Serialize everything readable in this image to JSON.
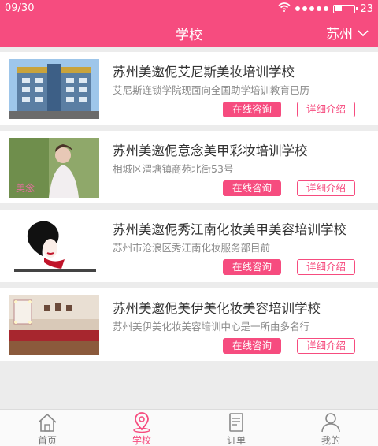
{
  "status": {
    "time": "09/30",
    "battery": "23"
  },
  "nav": {
    "title": "学校",
    "city": "苏州"
  },
  "schools": [
    {
      "name": "苏州美邀伲艾尼斯美妆培训学校",
      "desc": "艾尼斯连锁学院现面向全国助学培训教育已历",
      "consult": "在线咨询",
      "detail": "详细介绍"
    },
    {
      "name": "苏州美邀伲意念美甲彩妆培训学校",
      "desc": "相城区渭塘镇商苑北街53号",
      "consult": "在线咨询",
      "detail": "详细介绍"
    },
    {
      "name": "苏州美邀伲秀江南化妆美甲美容培训学校",
      "desc": "苏州市沧浪区秀江南化妆服务部目前",
      "consult": "在线咨询",
      "detail": "详细介绍"
    },
    {
      "name": "苏州美邀伲美伊美化妆美容培训学校",
      "desc": "苏州美伊美化妆美容培训中心是一所由多名行",
      "consult": "在线咨询",
      "detail": "详细介绍"
    }
  ],
  "tabs": [
    {
      "label": "首页",
      "icon": "home-icon"
    },
    {
      "label": "学校",
      "icon": "location-icon"
    },
    {
      "label": "订单",
      "icon": "order-icon"
    },
    {
      "label": "我的",
      "icon": "user-icon"
    }
  ],
  "colors": {
    "accent": "#f64c7f",
    "background": "#ececec"
  }
}
